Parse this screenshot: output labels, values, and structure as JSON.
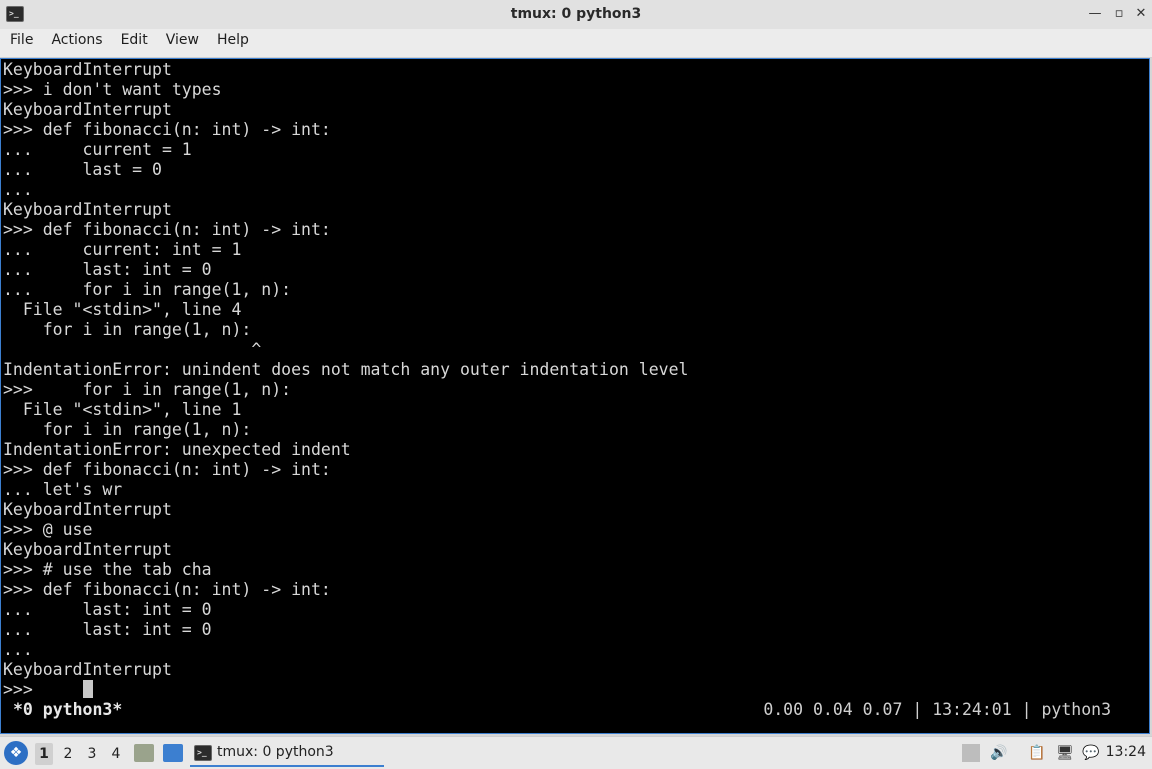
{
  "window": {
    "title": "tmux: 0 python3",
    "icon": "terminal-icon",
    "controls": {
      "minimize": "—",
      "maximize": "▫",
      "close": "✕"
    }
  },
  "menu": [
    "File",
    "Actions",
    "Edit",
    "View",
    "Help"
  ],
  "terminal": {
    "lines": [
      "KeyboardInterrupt",
      ">>> i don't want types",
      "KeyboardInterrupt",
      ">>> def fibonacci(n: int) -> int:",
      "...     current = 1",
      "...     last = 0",
      "...",
      "KeyboardInterrupt",
      ">>> def fibonacci(n: int) -> int:",
      "...     current: int = 1",
      "...     last: int = 0",
      "...     for i in range(1, n):",
      "  File \"<stdin>\", line 4",
      "    for i in range(1, n):",
      "                         ^",
      "IndentationError: unindent does not match any outer indentation level",
      ">>>     for i in range(1, n):",
      "  File \"<stdin>\", line 1",
      "    for i in range(1, n):",
      "IndentationError: unexpected indent",
      ">>> def fibonacci(n: int) -> int:",
      "... let's wr",
      "KeyboardInterrupt",
      ">>> @ use",
      "KeyboardInterrupt",
      ">>> # use the tab cha",
      ">>> def fibonacci(n: int) -> int:",
      "...     last: int = 0",
      "...     last: int = 0",
      "...",
      "KeyboardInterrupt",
      ">>>"
    ],
    "status_left": "*0 python3*",
    "status_right": "0.00 0.04 0.07 | 13:24:01 | python3"
  },
  "taskbar": {
    "workspaces": [
      "1",
      "2",
      "3",
      "4"
    ],
    "active_workspace": "1",
    "task_label": "tmux: 0 python3",
    "clock": "13:24",
    "colors": {
      "accent": "#3c7fd0",
      "terminal_bg": "#000000",
      "terminal_fg": "#d8d8d8"
    }
  }
}
